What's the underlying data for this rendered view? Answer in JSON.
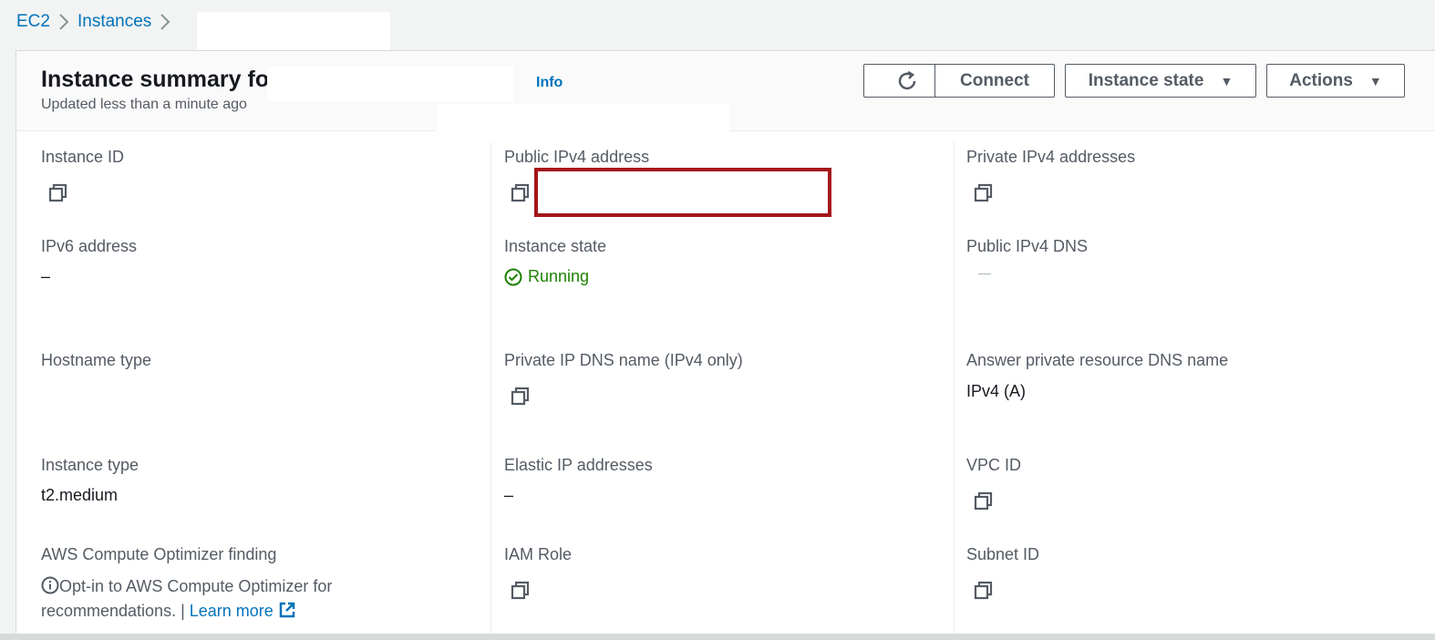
{
  "breadcrumb": {
    "ec2": "EC2",
    "instances": "Instances"
  },
  "header": {
    "title": "Instance summary for",
    "subtitle": "Updated less than a minute ago",
    "info": "Info",
    "buttons": {
      "connect": "Connect",
      "instance_state": "Instance state",
      "actions": "Actions"
    }
  },
  "fields": {
    "instance_id": {
      "label": "Instance ID"
    },
    "public_ipv4": {
      "label": "Public IPv4 address"
    },
    "private_ipv4": {
      "label": "Private IPv4 addresses"
    },
    "ipv6": {
      "label": "IPv6 address",
      "value": "–"
    },
    "instance_state": {
      "label": "Instance state",
      "value": "Running"
    },
    "public_dns": {
      "label": "Public IPv4 DNS"
    },
    "hostname_type": {
      "label": "Hostname type"
    },
    "private_dns": {
      "label": "Private IP DNS name (IPv4 only)"
    },
    "answer_dns": {
      "label": "Answer private resource DNS name",
      "value": "IPv4 (A)"
    },
    "instance_type": {
      "label": "Instance type",
      "value": "t2.medium"
    },
    "elastic_ip": {
      "label": "Elastic IP addresses",
      "value": "–"
    },
    "vpc_id": {
      "label": "VPC ID"
    },
    "optimizer": {
      "label": "AWS Compute Optimizer finding",
      "text": "Opt-in to AWS Compute Optimizer for recommendations. | ",
      "link": "Learn more"
    },
    "iam_role": {
      "label": "IAM Role"
    },
    "subnet_id": {
      "label": "Subnet ID"
    }
  },
  "colors": {
    "link": "#0073bb",
    "running": "#1d8102",
    "highlight": "#a4161a"
  }
}
